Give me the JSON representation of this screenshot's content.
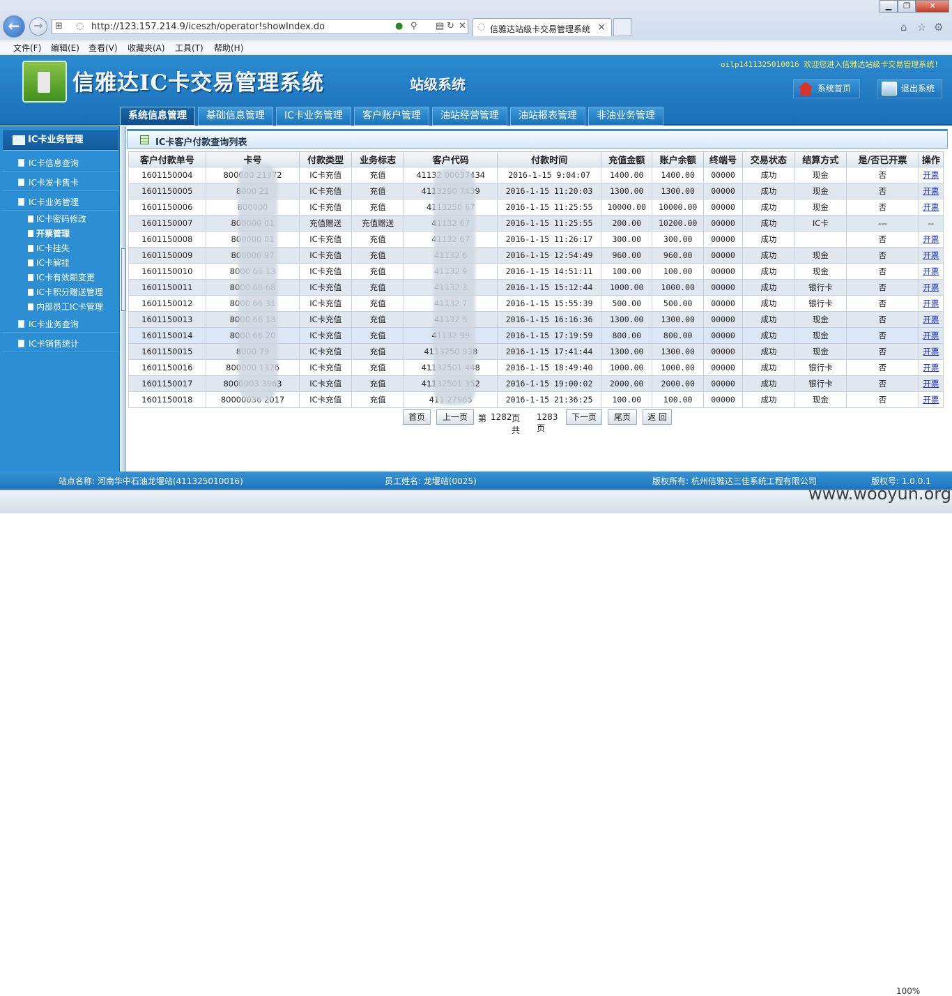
{
  "browser": {
    "url": "http://123.157.214.9/iceszh/operator!showIndex.do",
    "tab_title": "信雅达站级卡交易管理系统",
    "tab_close": "×",
    "menu": [
      "文件(F)",
      "编辑(E)",
      "查看(V)",
      "收藏夹(A)",
      "工具(T)",
      "帮助(H)"
    ],
    "zoom": "100%"
  },
  "header": {
    "title": "信雅达IC卡交易管理系统",
    "subtitle": "站级系统",
    "welcome": "oilp1411325010016 欢迎您进入信雅达站级卡交易管理系统!",
    "home_label": "系统首页",
    "exit_label": "退出系统",
    "tabs": [
      "系统信息管理",
      "基础信息管理",
      "IC卡业务管理",
      "客户账户管理",
      "油站经营管理",
      "油站报表管理",
      "非油业务管理"
    ]
  },
  "sidebar": {
    "title": "IC卡业务管理",
    "items": [
      "IC卡信息查询",
      "IC卡发卡售卡",
      "IC卡业务管理"
    ],
    "subitems": [
      "IC卡密码修改",
      "开票管理",
      "IC卡挂失",
      "IC卡解挂",
      "IC卡有效期变更",
      "IC卡积分赠送管理",
      "内部员工IC卡管理"
    ],
    "items_after": [
      "IC卡业务查询",
      "IC卡销售统计"
    ]
  },
  "panel": {
    "title": "IC卡客户付款查询列表"
  },
  "table": {
    "columns": [
      "客户付款单号",
      "卡号",
      "付款类型",
      "业务标志",
      "客户代码",
      "付款时间",
      "充值金额",
      "账户余额",
      "终端号",
      "交易状态",
      "结算方式",
      "是/否已开票",
      "操作"
    ],
    "rows": [
      [
        "1601150004",
        "800000   21372",
        "IC卡充值",
        "充值",
        "41132   00037434",
        "2016-1-15 9:04:07",
        "1400.00",
        "1400.00",
        "00000",
        "成功",
        "现金",
        "否",
        "开票"
      ],
      [
        "1601150005",
        "8000      21",
        "IC卡充值",
        "充值",
        "4113250    7439",
        "2016-1-15 11:20:03",
        "1300.00",
        "1300.00",
        "00000",
        "成功",
        "现金",
        "否",
        "开票"
      ],
      [
        "1601150006",
        "800000",
        "IC卡充值",
        "充值",
        "4113250     67",
        "2016-1-15 11:25:55",
        "10000.00",
        "10000.00",
        "00000",
        "成功",
        "现金",
        "否",
        "开票"
      ],
      [
        "1601150007",
        "800000      01",
        "充值赠送",
        "充值赠送",
        "41132      67",
        "2016-1-15 11:25:55",
        "200.00",
        "10200.00",
        "00000",
        "成功",
        "IC卡",
        "---",
        "--"
      ],
      [
        "1601150008",
        "800000      01",
        "IC卡充值",
        "充值",
        "41132      67",
        "2016-1-15 11:26:17",
        "300.00",
        "300.00",
        "00000",
        "成功",
        "",
        "否",
        "开票"
      ],
      [
        "1601150009",
        "800000     97",
        "IC卡充值",
        "充值",
        "41132      6",
        "2016-1-15 12:54:49",
        "960.00",
        "960.00",
        "00000",
        "成功",
        "现金",
        "否",
        "开票"
      ],
      [
        "1601150010",
        "8000    66  13",
        "IC卡充值",
        "充值",
        "41132     9",
        "2016-1-15 14:51:11",
        "100.00",
        "100.00",
        "00000",
        "成功",
        "现金",
        "否",
        "开票"
      ],
      [
        "1601150011",
        "8000    66  68",
        "IC卡充值",
        "充值",
        "41132     3",
        "2016-1-15 15:12:44",
        "1000.00",
        "1000.00",
        "00000",
        "成功",
        "银行卡",
        "否",
        "开票"
      ],
      [
        "1601150012",
        "8000    66  31",
        "IC卡充值",
        "充值",
        "41132     7",
        "2016-1-15 15:55:39",
        "500.00",
        "500.00",
        "00000",
        "成功",
        "银行卡",
        "否",
        "开票"
      ],
      [
        "1601150013",
        "8000    66  13",
        "IC卡充值",
        "充值",
        "41132    5",
        "2016-1-15 16:16:36",
        "1300.00",
        "1300.00",
        "00000",
        "成功",
        "现金",
        "否",
        "开票"
      ],
      [
        "1601150014",
        "8000    66  20",
        "IC卡充值",
        "充值",
        "41132    99",
        "2016-1-15 17:19:59",
        "800.00",
        "800.00",
        "00000",
        "成功",
        "现金",
        "否",
        "开票"
      ],
      [
        "1601150015",
        "8000      79",
        "IC卡充值",
        "充值",
        "4113250    938",
        "2016-1-15 17:41:44",
        "1300.00",
        "1300.00",
        "00000",
        "成功",
        "现金",
        "否",
        "开票"
      ],
      [
        "1601150016",
        "800000    1376",
        "IC卡充值",
        "充值",
        "41132501    448",
        "2016-1-15 18:49:40",
        "1000.00",
        "1000.00",
        "00000",
        "成功",
        "银行卡",
        "否",
        "开票"
      ],
      [
        "1601150017",
        "8000003    3963",
        "IC卡充值",
        "充值",
        "41132501    352",
        "2016-1-15 19:00:02",
        "2000.00",
        "2000.00",
        "00000",
        "成功",
        "银行卡",
        "否",
        "开票"
      ],
      [
        "1601150018",
        "80000036    2017",
        "IC卡充值",
        "充值",
        "411     27965",
        "2016-1-15 21:36:25",
        "100.00",
        "100.00",
        "00000",
        "成功",
        "现金",
        "否",
        "开票"
      ]
    ]
  },
  "pager": {
    "first": "首页",
    "prev": "上一页",
    "info_prefix": "第",
    "current": "1282",
    "info_mid": "页 共",
    "total": "1283页",
    "next": "下一页",
    "last": "尾页",
    "back": "返 回"
  },
  "footer": {
    "station": "站点名称: 河南华中石油龙堰站(411325010016)",
    "employee": "员工姓名: 龙堰站(0025)",
    "copyright": "版权所有: 杭州信雅达三佳系统工程有限公司",
    "version": "版权号: 1.0.0.1"
  },
  "watermark": "www.wooyun.org"
}
